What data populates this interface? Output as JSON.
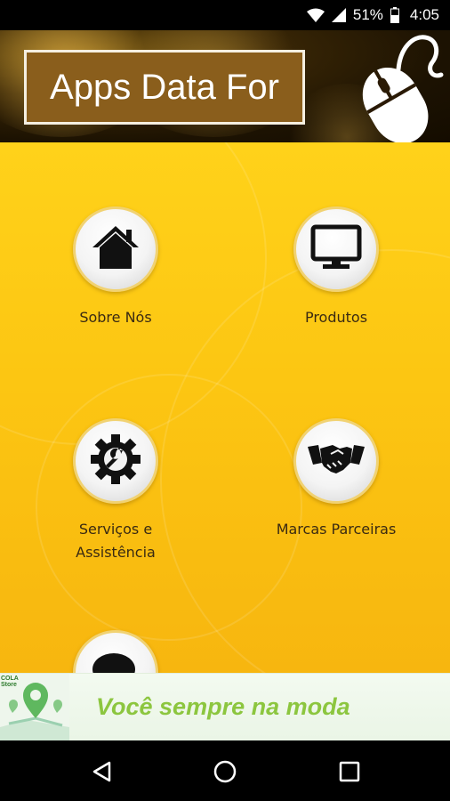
{
  "status_bar": {
    "battery_percent": "51%",
    "time": "4:05",
    "icons": [
      "wifi-icon",
      "cell-signal-icon",
      "battery-icon"
    ]
  },
  "header": {
    "title": "Apps Data For",
    "logo": "computer-mouse-icon"
  },
  "menu": {
    "items": [
      {
        "label": "Sobre Nós",
        "icon": "home-icon"
      },
      {
        "label": "Produtos",
        "icon": "monitor-icon"
      },
      {
        "label": "Serviços e\nAssistência",
        "icon": "gear-wrench-icon"
      },
      {
        "label": "Marcas Parceiras",
        "icon": "handshake-icon"
      },
      {
        "label": "",
        "icon": "chat-bubble-icon"
      }
    ]
  },
  "ad_banner": {
    "small_text": [
      "COLA",
      "Store"
    ],
    "text": "Você sempre na moda",
    "colors": {
      "text": "#8cc63f",
      "pin": "#5fb85f"
    }
  },
  "nav_bar": {
    "buttons": [
      "back-icon",
      "home-circle-icon",
      "recents-icon"
    ]
  },
  "colors": {
    "main_background": "#fcc612",
    "title_box": "#8a5e1c",
    "label_text": "#3a2a12"
  }
}
